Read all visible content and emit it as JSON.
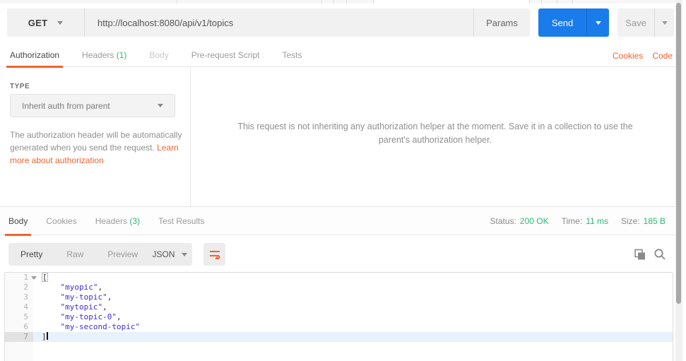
{
  "colors": {
    "accent_orange": "#F0642F",
    "primary_blue": "#1A7CEB",
    "success_green": "#2DB976",
    "json_string_color": "#3D2FD1"
  },
  "request_bar": {
    "method": "GET",
    "url": "http://localhost:8080/api/v1/topics",
    "params_button": "Params",
    "send_button": "Send",
    "save_button": "Save"
  },
  "request_tabs": {
    "authorization": "Authorization",
    "headers": "Headers",
    "headers_count": "(1)",
    "body": "Body",
    "prerequest_script": "Pre-request Script",
    "tests": "Tests",
    "cookies_link": "Cookies",
    "code_link": "Code"
  },
  "auth_panel": {
    "type_label": "TYPE",
    "type_value": "Inherit auth from parent",
    "description": "The authorization header will be automatically generated when you send the request. ",
    "learn_more_link": "Learn more about authorization",
    "helper_message": "This request is not inheriting any authorization helper at the moment. Save it in a collection to use the parent's authorization helper."
  },
  "response_panel": {
    "tab_body": "Body",
    "tab_cookies": "Cookies",
    "tab_headers": "Headers",
    "tab_headers_count": "(3)",
    "tab_test_results": "Test Results",
    "status_label": "Status:",
    "status_value": "200 OK",
    "time_label": "Time:",
    "time_value": "11 ms",
    "size_label": "Size:",
    "size_value": "185 B",
    "view_pretty": "Pretty",
    "view_raw": "Raw",
    "view_preview": "Preview",
    "format_select": "JSON"
  },
  "editor": {
    "lines": [
      {
        "num": "1",
        "open": "["
      },
      {
        "num": "2",
        "code": "    \"myopic\"",
        "comma": ","
      },
      {
        "num": "3",
        "code": "    \"my-topic\"",
        "comma": ","
      },
      {
        "num": "4",
        "code": "    \"mytopic\"",
        "comma": ","
      },
      {
        "num": "5",
        "code": "    \"my-topic-0\"",
        "comma": ","
      },
      {
        "num": "6",
        "code": "    \"my-second-topic\"",
        "comma": ""
      },
      {
        "num": "7",
        "close": "]"
      }
    ]
  }
}
